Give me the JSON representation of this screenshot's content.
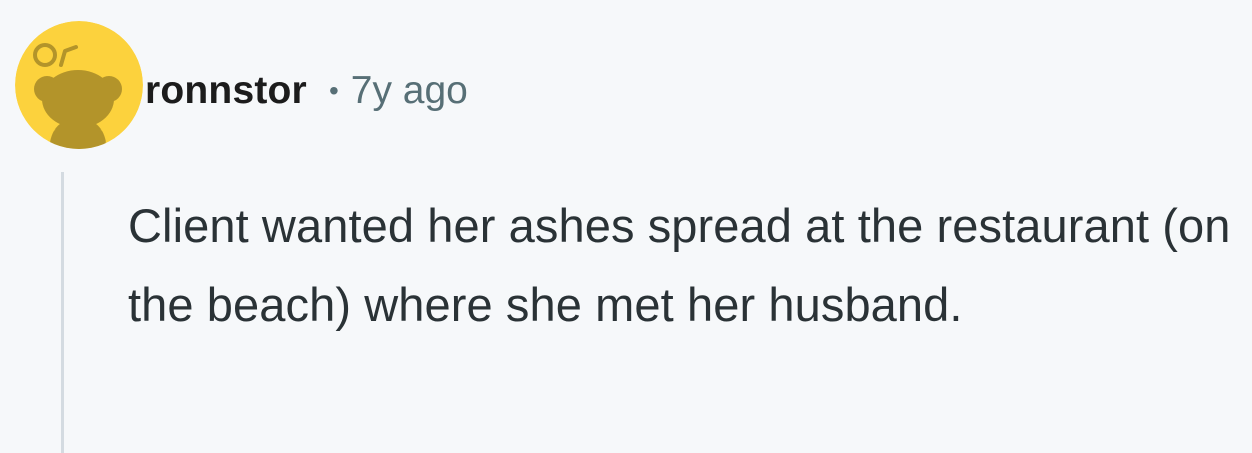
{
  "comment": {
    "username": "ronnstor",
    "separator": "•",
    "timestamp": "7y ago",
    "body": "Client wanted her ashes spread at the restaurant (on the beach) where she met her husband."
  },
  "avatar": {
    "icon": "snoo-default-avatar-icon",
    "background_color": "#fcd23d",
    "figure_color": "#b3942a"
  },
  "colors": {
    "page_background": "#f6f8fa",
    "username": "#1c1c1c",
    "meta": "#576f76",
    "body_text": "#2a3236",
    "thread_line": "#d4dbe1"
  }
}
